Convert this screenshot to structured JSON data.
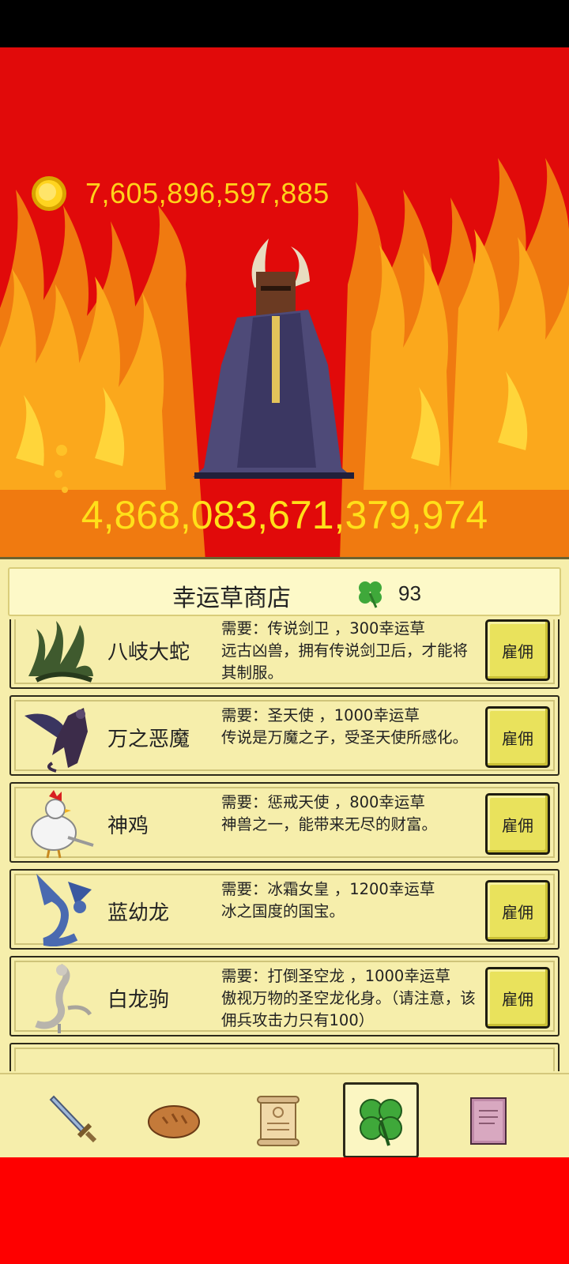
{
  "game": {
    "gold_amount": "7,605,896,597,885",
    "boss_hp": "4,868,083,671,379,974"
  },
  "shop": {
    "title": "幸运草商店",
    "clover_count": "93",
    "items": [
      {
        "icon": "eight-headed-serpent-icon",
        "name": "八岐大蛇",
        "line1": "需要：传说剑卫 ，300幸运草",
        "line2": "远古凶兽，拥有传说剑卫后，才能将其制服。",
        "button": "雇佣"
      },
      {
        "icon": "demon-icon",
        "name": "万之恶魔",
        "line1": "需要：圣天使 ，1000幸运草",
        "line2": "传说是万魔之子，受圣天使所感化。",
        "button": "雇佣"
      },
      {
        "icon": "rooster-icon",
        "name": "神鸡",
        "line1": "需要：惩戒天使 ，800幸运草",
        "line2": "神兽之一，能带来无尽的财富。",
        "button": "雇佣"
      },
      {
        "icon": "blue-dragon-icon",
        "name": "蓝幼龙",
        "line1": "需要：冰霜女皇 ，1200幸运草",
        "line2": "冰之国度的国宝。",
        "button": "雇佣"
      },
      {
        "icon": "white-dragon-icon",
        "name": "白龙驹",
        "line1": "需要：打倒圣空龙 ，1000幸运草",
        "line2": "傲视万物的圣空龙化身。（请注意，该佣兵攻击力只有100）",
        "button": "雇佣"
      }
    ]
  },
  "tabs": [
    {
      "icon": "sword-icon",
      "active": false
    },
    {
      "icon": "bread-icon",
      "active": false
    },
    {
      "icon": "scroll-icon",
      "active": false
    },
    {
      "icon": "clover-icon",
      "active": true
    },
    {
      "icon": "book-icon",
      "active": false
    }
  ]
}
